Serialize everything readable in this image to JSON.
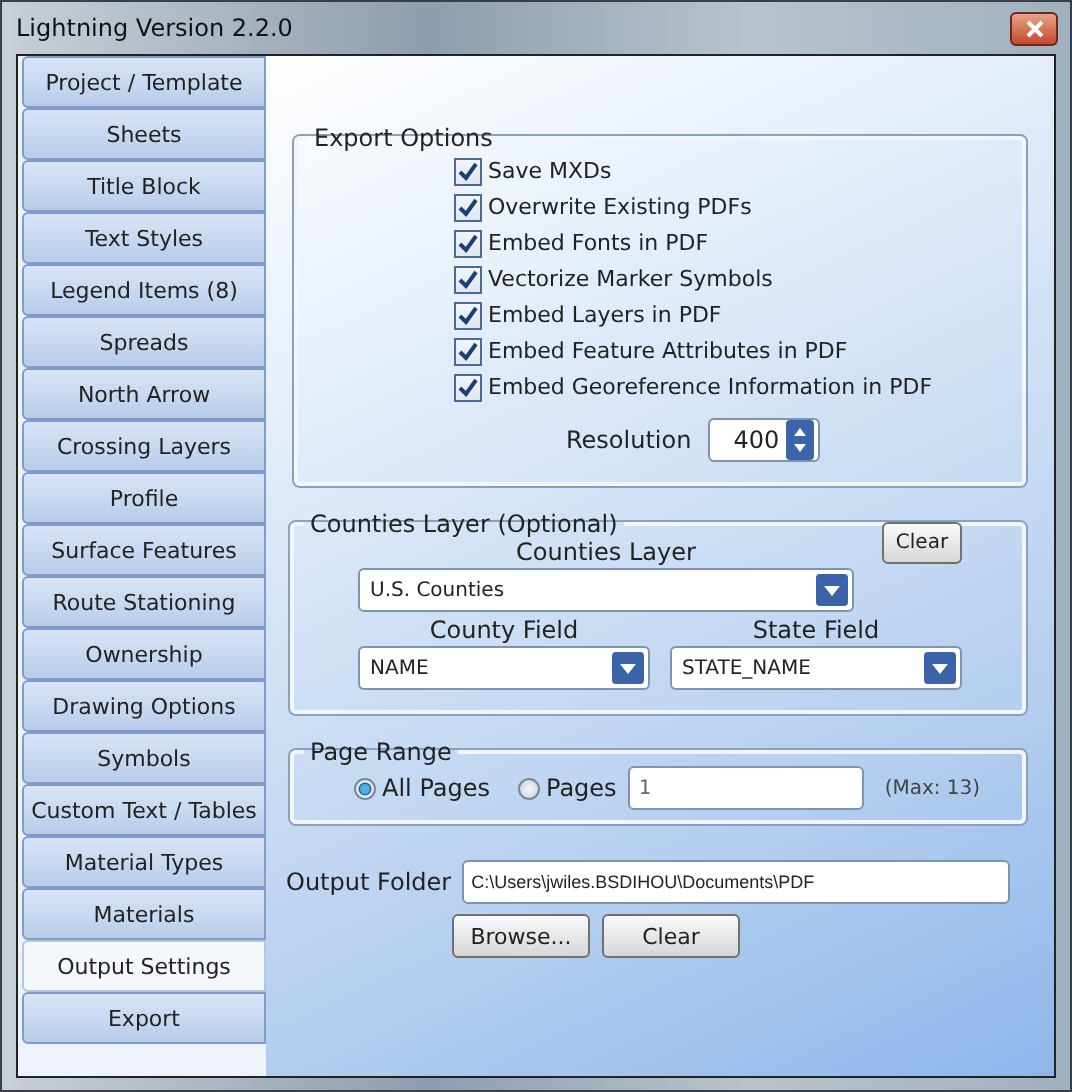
{
  "window": {
    "title": "Lightning Version 2.2.0"
  },
  "sidebar": {
    "items": [
      {
        "label": "Project / Template",
        "selected": false
      },
      {
        "label": "Sheets",
        "selected": false
      },
      {
        "label": "Title Block",
        "selected": false
      },
      {
        "label": "Text Styles",
        "selected": false
      },
      {
        "label": "Legend Items (8)",
        "selected": false
      },
      {
        "label": "Spreads",
        "selected": false
      },
      {
        "label": "North Arrow",
        "selected": false
      },
      {
        "label": "Crossing Layers",
        "selected": false
      },
      {
        "label": "Profile",
        "selected": false
      },
      {
        "label": "Surface Features",
        "selected": false
      },
      {
        "label": "Route Stationing",
        "selected": false
      },
      {
        "label": "Ownership",
        "selected": false
      },
      {
        "label": "Drawing Options",
        "selected": false
      },
      {
        "label": "Symbols",
        "selected": false
      },
      {
        "label": "Custom Text / Tables",
        "selected": false
      },
      {
        "label": "Material Types",
        "selected": false
      },
      {
        "label": "Materials",
        "selected": false
      },
      {
        "label": "Output Settings",
        "selected": true
      },
      {
        "label": "Export",
        "selected": false
      }
    ]
  },
  "export_options": {
    "title": "Export Options",
    "options": [
      {
        "label": "Save MXDs",
        "checked": true
      },
      {
        "label": "Overwrite Existing PDFs",
        "checked": true
      },
      {
        "label": "Embed Fonts in PDF",
        "checked": true
      },
      {
        "label": "Vectorize Marker Symbols",
        "checked": true
      },
      {
        "label": "Embed Layers in PDF",
        "checked": true
      },
      {
        "label": "Embed Feature Attributes in PDF",
        "checked": true
      },
      {
        "label": "Embed Georeference Information in PDF",
        "checked": true
      }
    ],
    "resolution": {
      "label": "Resolution",
      "value": "400"
    }
  },
  "counties_layer": {
    "title": "Counties Layer (Optional)",
    "layer_label": "Counties Layer",
    "layer_value": "U.S. Counties",
    "clear_button": "Clear",
    "county_field_label": "County Field",
    "county_field_value": "NAME",
    "state_field_label": "State Field",
    "state_field_value": "STATE_NAME"
  },
  "page_range": {
    "title": "Page Range",
    "options": [
      {
        "label": "All Pages",
        "selected": true
      },
      {
        "label": "Pages",
        "selected": false
      }
    ],
    "pages_value": "1",
    "max_note": "(Max: 13)"
  },
  "output_folder": {
    "label": "Output Folder",
    "value": "C:\\Users\\jwiles.BSDIHOU\\Documents\\PDF",
    "browse_button": "Browse...",
    "clear_button": "Clear"
  }
}
